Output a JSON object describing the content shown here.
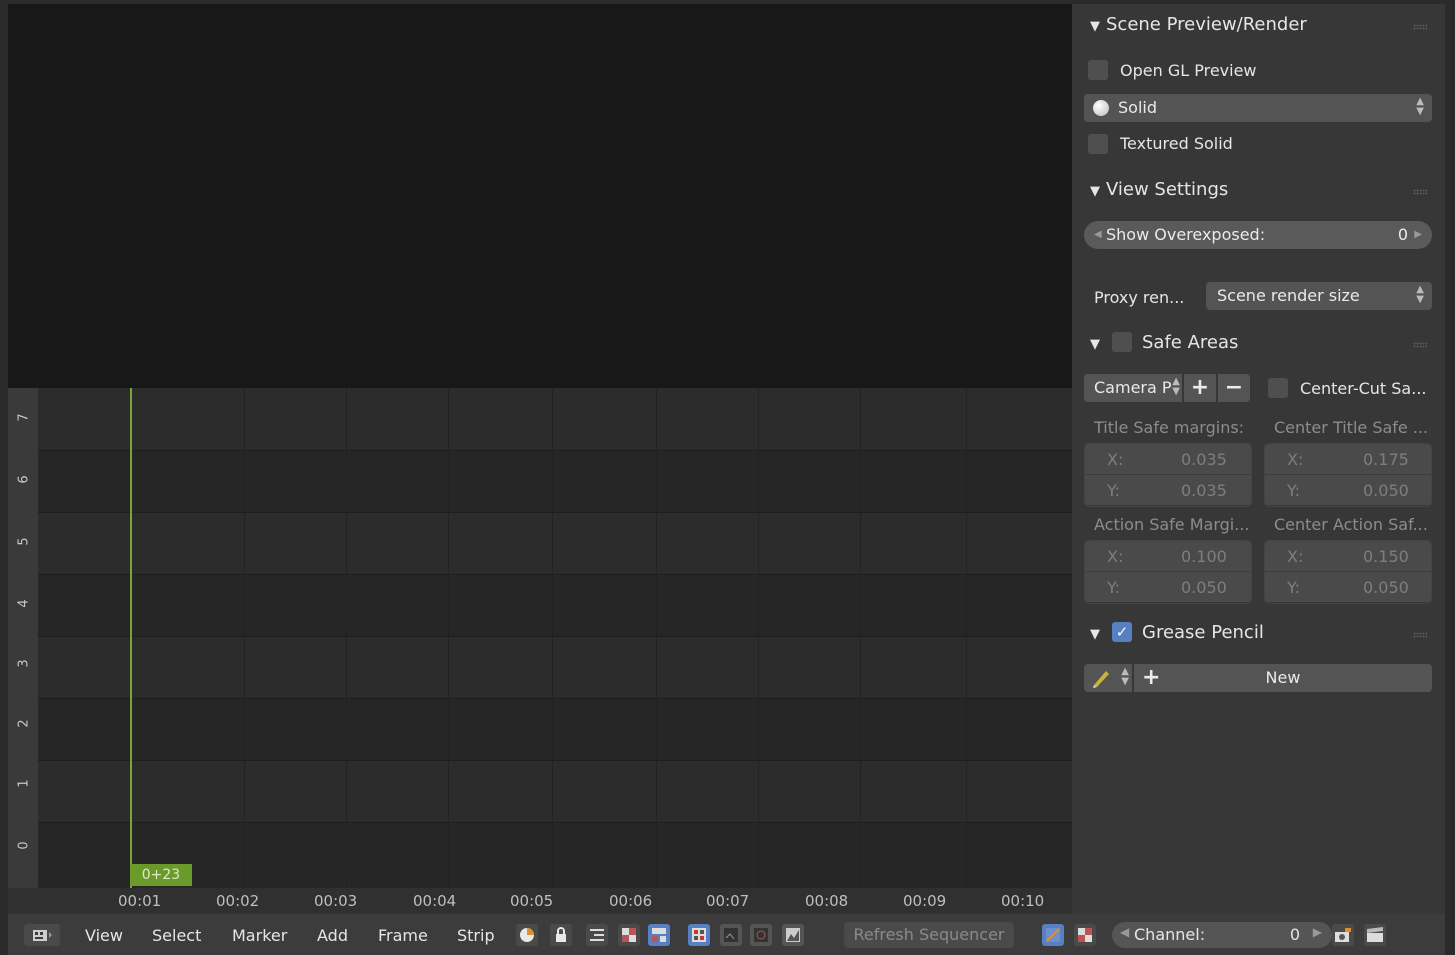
{
  "sequencer": {
    "channels": [
      "7",
      "6",
      "5",
      "4",
      "3",
      "2",
      "1",
      "0"
    ],
    "frame_badge": "0+23",
    "timeline_ticks": [
      "00:01",
      "00:02",
      "00:03",
      "00:04",
      "00:05",
      "00:06",
      "00:07",
      "00:08",
      "00:09",
      "00:10"
    ]
  },
  "header": {
    "menus": [
      "View",
      "Select",
      "Marker",
      "Add",
      "Frame",
      "Strip"
    ],
    "refresh_label": "Refresh Sequencer",
    "channel_label": "Channel:",
    "channel_value": "0"
  },
  "panel": {
    "scene_preview": {
      "title": "Scene Preview/Render",
      "opengl_preview_label": "Open GL Preview",
      "shading_value": "Solid",
      "textured_solid_label": "Textured Solid"
    },
    "view_settings": {
      "title": "View Settings",
      "show_overexposed_label": "Show Overexposed:",
      "show_overexposed_value": "0",
      "proxy_label": "Proxy ren...",
      "proxy_value": "Scene render size"
    },
    "safe_areas": {
      "title": "Safe Areas",
      "preset_value": "Camera P",
      "center_cut_label": "Center-Cut Sa...",
      "title_safe_label": "Title Safe margins:",
      "center_title_safe_label": "Center Title Safe ...",
      "title_safe": {
        "x": "0.035",
        "y": "0.035"
      },
      "center_title_safe": {
        "x": "0.175",
        "y": "0.050"
      },
      "action_safe_label": "Action Safe Margi...",
      "center_action_safe_label": "Center Action Saf...",
      "action_safe": {
        "x": "0.100",
        "y": "0.050"
      },
      "center_action_safe": {
        "x": "0.150",
        "y": "0.050"
      },
      "x_label": "X:",
      "y_label": "Y:"
    },
    "grease_pencil": {
      "title": "Grease Pencil",
      "enabled": true,
      "new_label": "New"
    }
  },
  "colors": {
    "accent": "#5680c2",
    "playhead": "#7aa33a"
  }
}
